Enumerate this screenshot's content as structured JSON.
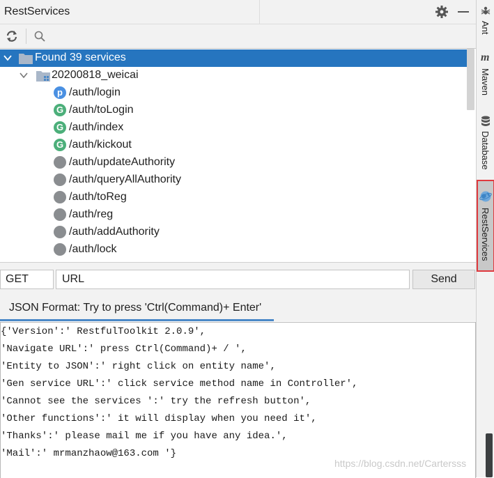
{
  "panel": {
    "title": "RestServices"
  },
  "tree": {
    "root_label": "Found 39 services",
    "module_label": "20200818_weicai",
    "services": [
      {
        "method_letter": "p",
        "color": "#4a90e2",
        "path": "/auth/login"
      },
      {
        "method_letter": "G",
        "color": "#4caf7a",
        "path": "/auth/toLogin"
      },
      {
        "method_letter": "G",
        "color": "#4caf7a",
        "path": "/auth/index"
      },
      {
        "method_letter": "G",
        "color": "#4caf7a",
        "path": "/auth/kickout"
      },
      {
        "method_letter": "",
        "color": "#8a8d90",
        "path": "/auth/updateAuthority"
      },
      {
        "method_letter": "",
        "color": "#8a8d90",
        "path": "/auth/queryAllAuthority"
      },
      {
        "method_letter": "",
        "color": "#8a8d90",
        "path": "/auth/toReg"
      },
      {
        "method_letter": "",
        "color": "#8a8d90",
        "path": "/auth/reg"
      },
      {
        "method_letter": "",
        "color": "#8a8d90",
        "path": "/auth/addAuthority"
      },
      {
        "method_letter": "",
        "color": "#8a8d90",
        "path": "/auth/lock"
      }
    ]
  },
  "request": {
    "method": "GET",
    "url": "URL",
    "send_label": "Send"
  },
  "tab": {
    "label": "JSON Format: Try to press 'Ctrl(Command)+ Enter'"
  },
  "editor": {
    "lines": [
      "{'Version':' RestfulToolkit 2.0.9',",
      "'Navigate URL':' press Ctrl(Command)+ / ',",
      "'Entity to JSON':' right click on entity name',",
      "'Gen service URL':' click service method name in Controller',",
      "'Cannot see the services ':' try the refresh button',",
      "'Other functions':' it will display when you need it',",
      "'Thanks':' please mail me if you have any idea.',",
      "'Mail':' mrmanzhaow@163.com '}"
    ]
  },
  "watermark": "https://blog.csdn.net/Cartersss",
  "sidebar": {
    "tabs": [
      {
        "label": "Ant",
        "icon": "ant-icon"
      },
      {
        "label": "Maven",
        "icon": "maven-icon"
      },
      {
        "label": "Database",
        "icon": "database-icon"
      },
      {
        "label": "RestServices",
        "icon": "globe-icon"
      }
    ]
  },
  "colors": {
    "selection": "#2675bf",
    "highlight_border": "#e0393e"
  }
}
